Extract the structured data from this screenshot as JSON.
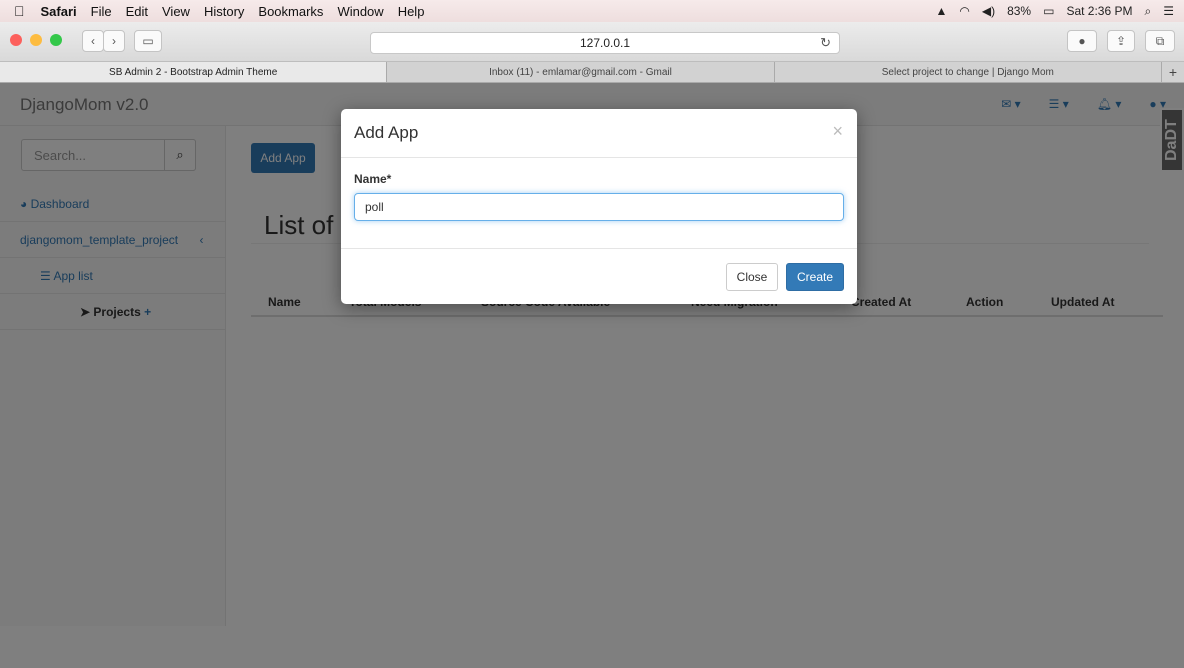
{
  "menubar": {
    "apple_icon": "apple-icon",
    "items": [
      "Safari",
      "File",
      "Edit",
      "View",
      "History",
      "Bookmarks",
      "Window",
      "Help"
    ],
    "battery": "83%",
    "clock": "Sat 2:36 PM"
  },
  "browser": {
    "url": "127.0.0.1",
    "tabs": [
      {
        "label": "SB Admin 2 - Bootstrap Admin Theme"
      },
      {
        "label": "Inbox (11) - emlamar@gmail.com - Gmail"
      },
      {
        "label": "Select project to change | Django Mom"
      }
    ]
  },
  "app": {
    "brand": "DjangoMom v2.0",
    "search_placeholder": "Search...",
    "sidebar": {
      "dashboard": "Dashboard",
      "project": "djangomom_template_project",
      "app_list": "App list",
      "projects": "Projects"
    },
    "add_button": "Add App",
    "page_title": "List of",
    "table_headers": [
      "Name",
      "Total Models",
      "Source Code Available",
      "Need Migration",
      "Created At",
      "Action",
      "Updated At"
    ]
  },
  "badge": "DaDT",
  "modal": {
    "title": "Add App",
    "close_symbol": "×",
    "name_label": "Name*",
    "name_value": "poll",
    "close_button": "Close",
    "create_button": "Create"
  },
  "colors": {
    "primary": "#337ab7",
    "traffic_red": "#fc605c",
    "traffic_yellow": "#fdbc40",
    "traffic_green": "#34c84a"
  }
}
